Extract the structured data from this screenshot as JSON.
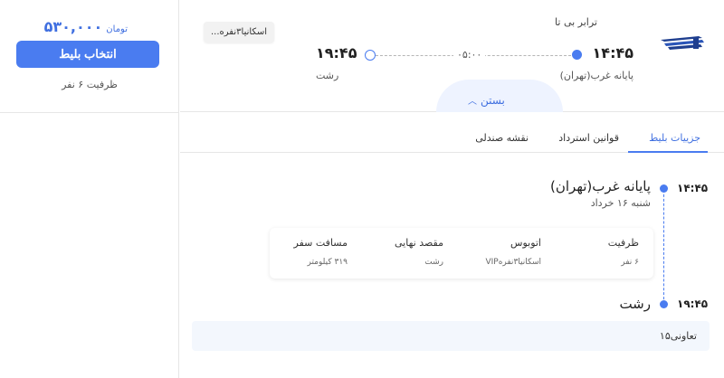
{
  "price": {
    "value": "۵۳۰,۰۰۰",
    "unit": "تومان"
  },
  "select_button": "انتخاب بلیط",
  "capacity": "ظرفیت ۶ نفر",
  "company": "ترابر بی تا",
  "bus_chip": "اسکانیا۳نفره...",
  "departure": {
    "time": "۱۴:۴۵",
    "city": "پایانه غرب(تهران)"
  },
  "arrival": {
    "time": "۱۹:۴۵",
    "city": "رشت"
  },
  "duration": "۰۵:۰۰",
  "close_label": "بستن",
  "tabs": [
    {
      "label": "جزییات بلیط",
      "active": true
    },
    {
      "label": "قوانین استرداد",
      "active": false
    },
    {
      "label": "نقشه صندلی",
      "active": false
    }
  ],
  "timeline": {
    "start": {
      "time": "۱۴:۴۵",
      "city": "پایانه غرب(تهران)",
      "date": "شنبه ۱۶ خرداد"
    },
    "end": {
      "time": "۱۹:۴۵",
      "city": "رشت"
    }
  },
  "info": {
    "headers": [
      "ظرفیت",
      "اتوبوس",
      "مقصد نهایی",
      "مسافت سفر"
    ],
    "values": [
      "۶ نفر",
      "اسکانیا۳نفرهVIP",
      "رشت",
      "۳۱۹ کیلومتر"
    ]
  },
  "cooperative": "تعاونی۱۵",
  "colors": {
    "accent": "#4a7cf0",
    "price": "#3f6fe0",
    "coop_bg": "#f3f7fd"
  },
  "icons": {
    "logo": "company-logo",
    "close_chevron": "chevron-up-icon"
  }
}
